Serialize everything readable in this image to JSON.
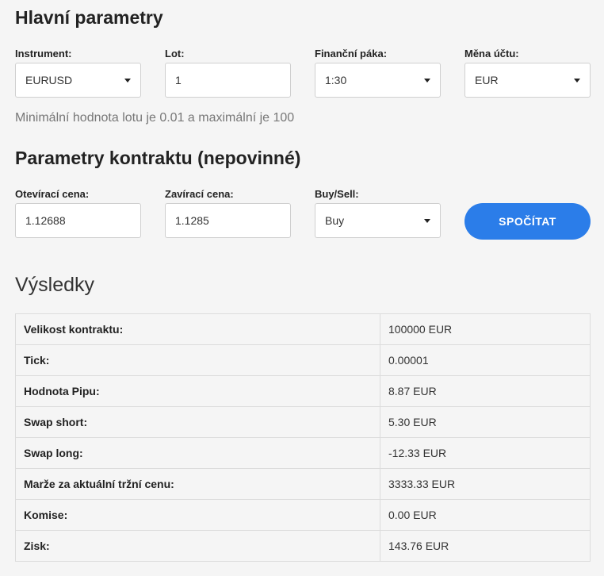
{
  "main": {
    "title": "Hlavní parametry",
    "instrument": {
      "label": "Instrument:",
      "value": "EURUSD"
    },
    "lot": {
      "label": "Lot:",
      "value": "1"
    },
    "leverage": {
      "label": "Finanční páka:",
      "value": "1:30"
    },
    "currency": {
      "label": "Měna účtu:",
      "value": "EUR"
    },
    "hint": "Minimální hodnota lotu je 0.01 a maximální je 100"
  },
  "contract": {
    "title": "Parametry kontraktu (nepovinné)",
    "open_price": {
      "label": "Otevírací cena:",
      "value": "1.12688"
    },
    "close_price": {
      "label": "Zavírací cena:",
      "value": "1.1285"
    },
    "direction": {
      "label": "Buy/Sell:",
      "value": "Buy"
    },
    "calculate_label": "SPOČÍTAT"
  },
  "results": {
    "title": "Výsledky",
    "rows": [
      {
        "key": "Velikost kontraktu:",
        "value": "100000 EUR"
      },
      {
        "key": "Tick:",
        "value": "0.00001"
      },
      {
        "key": "Hodnota Pipu:",
        "value": "8.87 EUR"
      },
      {
        "key": "Swap short:",
        "value": "5.30 EUR"
      },
      {
        "key": "Swap long:",
        "value": "-12.33 EUR"
      },
      {
        "key": "Marže za aktuální tržní cenu:",
        "value": "3333.33 EUR"
      },
      {
        "key": "Komise:",
        "value": "0.00 EUR"
      },
      {
        "key": "Zisk:",
        "value": "143.76 EUR"
      }
    ]
  },
  "colors": {
    "accent": "#2b7de9",
    "background": "#f5f5f5"
  }
}
